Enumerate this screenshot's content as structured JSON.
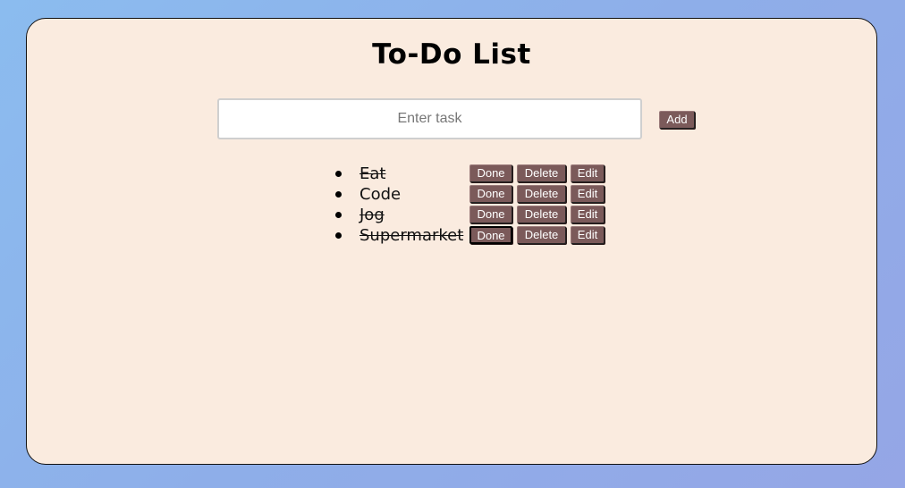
{
  "app": {
    "title": "To-Do List"
  },
  "input": {
    "placeholder": "Enter task",
    "value": ""
  },
  "buttons": {
    "add_label": "Add",
    "done_label": "Done",
    "delete_label": "Delete",
    "edit_label": "Edit"
  },
  "tasks": [
    {
      "text": "Eat",
      "completed": true
    },
    {
      "text": "Code",
      "completed": false
    },
    {
      "text": "Jog",
      "completed": true
    },
    {
      "text": "Supermarket",
      "completed": true
    }
  ],
  "colors": {
    "background_start": "#8bbcef",
    "background_end": "#95a6e6",
    "card": "#faebdf",
    "button": "#7b5a5a",
    "button_text": "#ffffff"
  }
}
